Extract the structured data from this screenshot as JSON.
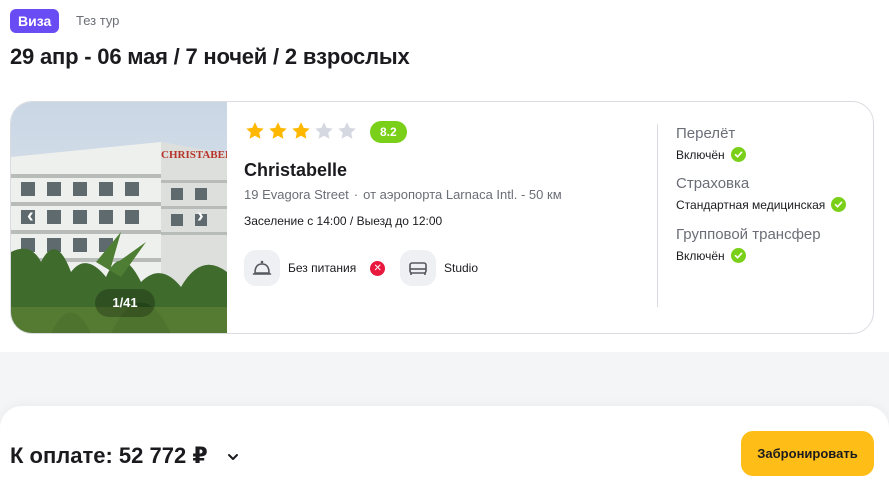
{
  "header": {
    "visa_badge": "Виза",
    "tour_name": "Тез тур",
    "trip_title": "29 апр - 06 мая / 7 ночей / 2 взрослых"
  },
  "hotel": {
    "photo_counter": "1/41",
    "photo_sign": "CHRISTABELLE HOTEL",
    "stars_filled": 3,
    "stars_total": 5,
    "rating": "8.2",
    "name": "Christabelle",
    "address": "19 Evagora Street",
    "airport_distance": "от аэропорта Larnaca Intl. - 50 км",
    "checkin": "Заселение с 14:00 / Выезд до 12:00",
    "meal_label": "Без питания",
    "room_label": "Studio"
  },
  "services": {
    "flight_title": "Перелёт",
    "flight_value": "Включён",
    "insurance_title": "Страховка",
    "insurance_value": "Стандартная медицинская",
    "transfer_title": "Групповой трансфер",
    "transfer_value": "Включён"
  },
  "footer": {
    "pay_label": "К оплате: 52 772 ₽",
    "book_button": "Забронировать"
  },
  "colors": {
    "visa_badge": "#6a4cf5",
    "star_filled": "#ffb800",
    "star_empty": "#d5d8e0",
    "rating_badge": "#7ad019",
    "check": "#7ad019",
    "cross": "#e8193c",
    "book_button": "#ffbd17"
  },
  "icons": {
    "meal": "cloche-icon",
    "room": "bed-icon",
    "prev": "chevron-left-icon",
    "next": "chevron-right-icon",
    "expand": "chevron-down-icon"
  }
}
